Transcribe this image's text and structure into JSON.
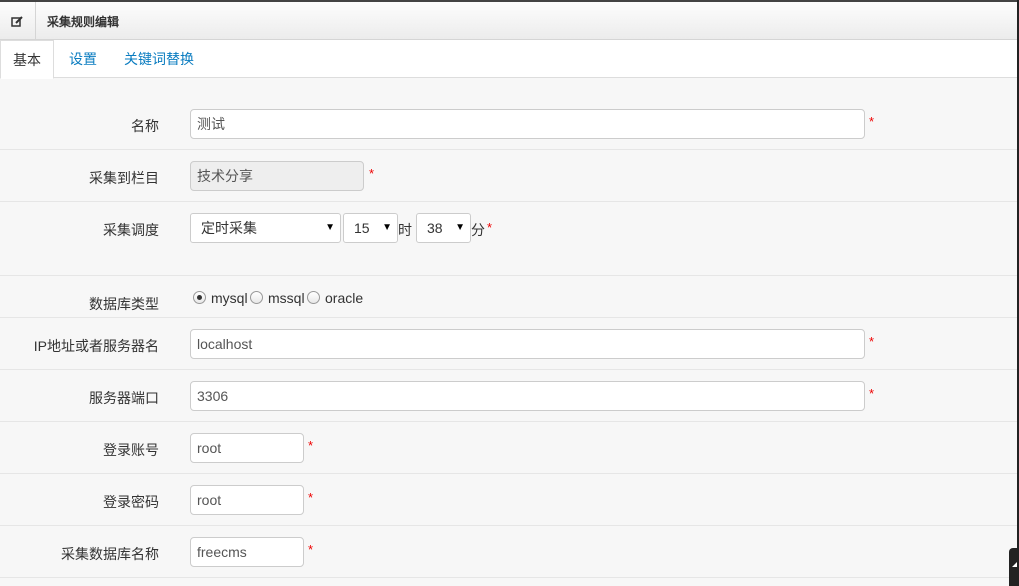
{
  "header": {
    "title": "采集规则编辑",
    "icon": "edit-icon"
  },
  "tabs": [
    {
      "label": "基本",
      "active": true
    },
    {
      "label": "设置",
      "active": false
    },
    {
      "label": "关键词替换",
      "active": false
    }
  ],
  "form": {
    "name": {
      "label": "名称",
      "value": "测试",
      "required": "*"
    },
    "channel": {
      "label": "采集到栏目",
      "value": "技术分享",
      "required": "*"
    },
    "schedule": {
      "label": "采集调度",
      "mode": "定时采集",
      "hour": "15",
      "hour_unit": "时",
      "minute": "38",
      "minute_unit": "分",
      "required": "*"
    },
    "db_type": {
      "label": "数据库类型",
      "options": [
        "mysql",
        "mssql",
        "oracle"
      ],
      "selected": "mysql"
    },
    "host": {
      "label": "IP地址或者服务器名",
      "value": "localhost",
      "required": "*"
    },
    "port": {
      "label": "服务器端口",
      "value": "3306",
      "required": "*"
    },
    "user": {
      "label": "登录账号",
      "value": "root",
      "required": "*"
    },
    "password": {
      "label": "登录密码",
      "value": "root",
      "required": "*"
    },
    "db_name": {
      "label": "采集数据库名称",
      "value": "freecms",
      "required": "*"
    }
  },
  "colors": {
    "link": "#0a7cc0",
    "required": "#e00000",
    "disabled_bg": "#eeeeee"
  }
}
